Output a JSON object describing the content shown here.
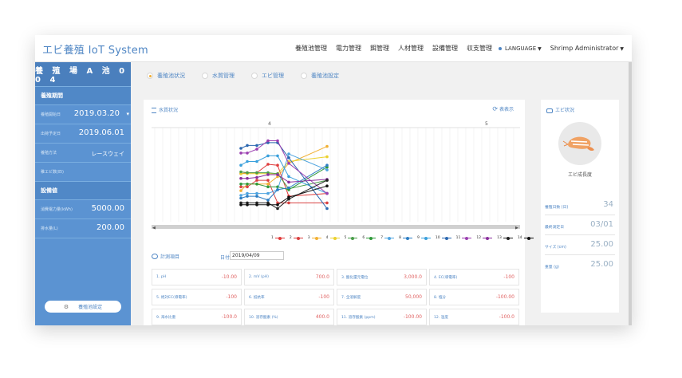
{
  "header": {
    "brand": "エビ養殖 IoT System",
    "nav": [
      "養殖池管理",
      "電力管理",
      "餌管理",
      "人材管理",
      "設備管理",
      "収支管理"
    ],
    "language": "LANGUAGE",
    "user": "Shrimp Administrator"
  },
  "sidebar": {
    "pond_title": "養 殖 場  A  池  0 0 4",
    "section1": "養殖期間",
    "start_label": "養殖開始日",
    "start_value": "2019.03.20",
    "end_label": "出荷予定日",
    "end_value": "2019.06.01",
    "method_label": "養殖方法",
    "method_value": "レースウェイ",
    "stock_label": "稚エビ数(匹)",
    "section2": "設備値",
    "elec_label": "消費電力量(kWh)",
    "elec_value": "5000.00",
    "water_label": "排水量(L)",
    "water_value": "200.00",
    "settings_button": "養殖池設定"
  },
  "tabs": [
    {
      "label": "養殖池状況",
      "active": true
    },
    {
      "label": "水質管理",
      "active": false
    },
    {
      "label": "エビ管理",
      "active": false
    },
    {
      "label": "養殖池設定",
      "active": false
    }
  ],
  "water": {
    "title": "水質状況",
    "toggle": "表表示"
  },
  "chart_data": {
    "type": "line",
    "x": [
      0,
      1,
      2,
      3,
      4,
      5,
      6
    ],
    "marker_labels": [
      "4",
      "5"
    ],
    "ylim": [
      0,
      100
    ],
    "series": [
      {
        "name": "1",
        "color": "#e03c3c",
        "values": [
          51,
          52,
          52,
          61,
          60,
          27,
          30
        ]
      },
      {
        "name": "2",
        "color": "#d94040",
        "values": [
          37,
          37,
          44,
          44,
          20,
          20,
          20
        ]
      },
      {
        "name": "3",
        "color": "#f2b134",
        "values": [
          33,
          40,
          40,
          40,
          48,
          62,
          80
        ]
      },
      {
        "name": "4",
        "color": "#ecd12e",
        "values": [
          51,
          51,
          51,
          51,
          51,
          64,
          69
        ]
      },
      {
        "name": "5",
        "color": "#4a9e4a",
        "values": [
          53,
          52,
          52,
          52,
          51,
          35,
          44
        ]
      },
      {
        "name": "6",
        "color": "#2f9a3a",
        "values": [
          40,
          40,
          40,
          37,
          37,
          34,
          58
        ]
      },
      {
        "name": "7",
        "color": "#4ea4e0",
        "values": [
          28,
          30,
          30,
          30,
          34,
          72,
          55
        ]
      },
      {
        "name": "8",
        "color": "#2d7ec4",
        "values": [
          25,
          27,
          27,
          23,
          34,
          36,
          60
        ]
      },
      {
        "name": "9",
        "color": "#3aa0dc",
        "values": [
          60,
          64,
          64,
          70,
          70,
          48,
          30
        ]
      },
      {
        "name": "10",
        "color": "#2b67b0",
        "values": [
          78,
          81,
          81,
          84,
          84,
          68,
          14
        ]
      },
      {
        "name": "11",
        "color": "#9b3fb0",
        "values": [
          73,
          73,
          77,
          86,
          86,
          62,
          30
        ]
      },
      {
        "name": "12",
        "color": "#8a2f9d",
        "values": [
          46,
          46,
          47,
          50,
          50,
          42,
          45
        ]
      },
      {
        "name": "13",
        "color": "#222222",
        "values": [
          20,
          20,
          20,
          20,
          14,
          24,
          44
        ]
      },
      {
        "name": "14",
        "color": "#111111",
        "values": [
          18,
          18,
          18,
          18,
          18,
          26,
          38
        ]
      }
    ]
  },
  "calc": {
    "title": "計測項目",
    "date_label": "日付",
    "date_value": "2019/04/09",
    "items": [
      {
        "label": "1. pH",
        "value": "-10.00"
      },
      {
        "label": "2. mV (pH)",
        "value": "700.0"
      },
      {
        "label": "3. 酸化還元電位",
        "value": "3,000.0"
      },
      {
        "label": "4. EC(導電率)",
        "value": "-100"
      },
      {
        "label": "5. 絶対EC(導電率)",
        "value": "-100"
      },
      {
        "label": "6. 抵抗率",
        "value": "-100"
      },
      {
        "label": "7. 全溶解度",
        "value": "50,000"
      },
      {
        "label": "8. 塩分",
        "value": "-100.00"
      },
      {
        "label": "9. 海水比重",
        "value": "-100.0"
      },
      {
        "label": "10. 溶存酸素 (%)",
        "value": "400.0"
      },
      {
        "label": "11. 溶存酸素 (ppm)",
        "value": "-100.00"
      },
      {
        "label": "12. 温度",
        "value": "-100.0"
      }
    ]
  },
  "shrimp": {
    "title": "エビ状況",
    "size_label": "エビ成長度",
    "rows": [
      {
        "label": "養殖日数 (日)",
        "value": "34"
      },
      {
        "label": "最終測定日",
        "value": "03/01"
      },
      {
        "label": "サイズ (cm)",
        "value": "25.00"
      },
      {
        "label": "重量 (g)",
        "value": "25.00"
      }
    ]
  }
}
